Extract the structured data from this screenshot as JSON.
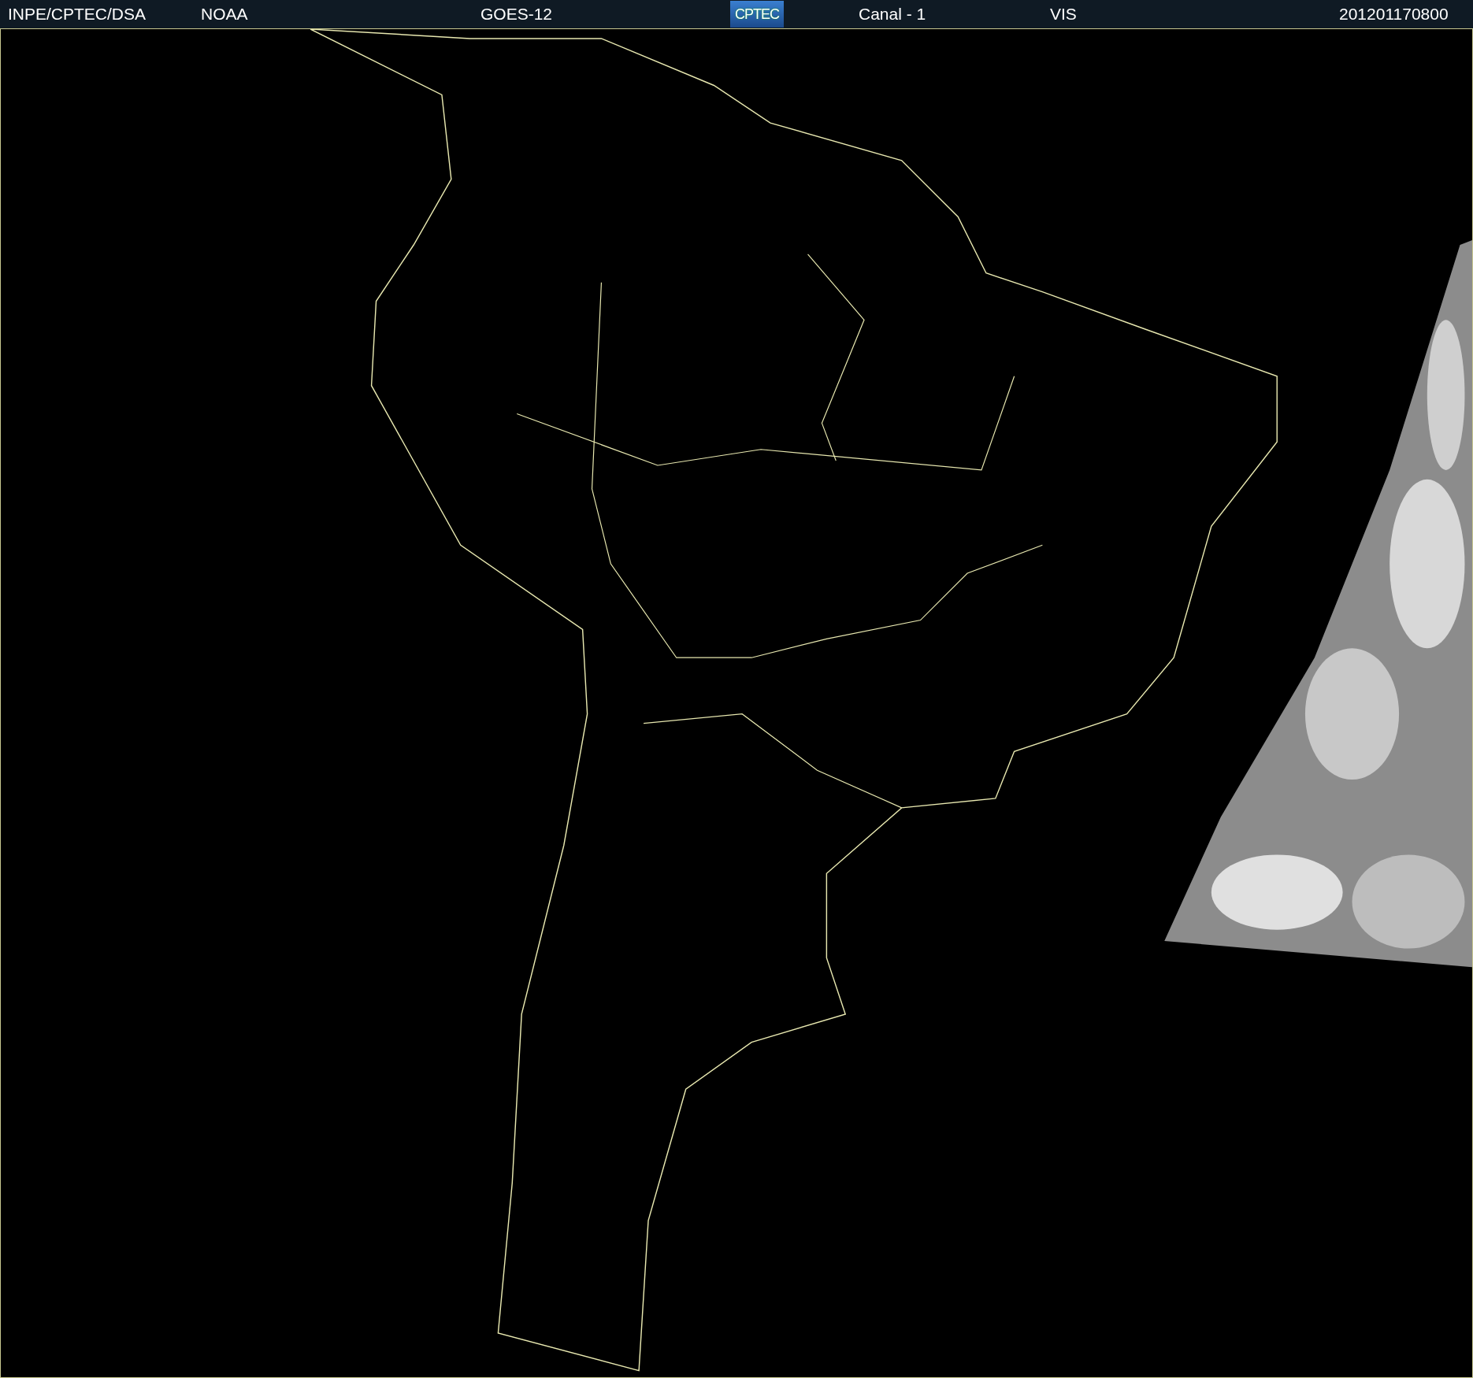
{
  "header": {
    "items": [
      {
        "kind": "text",
        "text": "INPE/CPTEC/DSA"
      },
      {
        "kind": "text",
        "text": "NOAA"
      },
      {
        "kind": "text",
        "text": "GOES-12"
      },
      {
        "kind": "logo",
        "text": "CPTEC"
      },
      {
        "kind": "text",
        "text": "Canal - 1"
      },
      {
        "kind": "text",
        "text": "VIS"
      },
      {
        "kind": "text",
        "text": "201201170800"
      }
    ]
  }
}
